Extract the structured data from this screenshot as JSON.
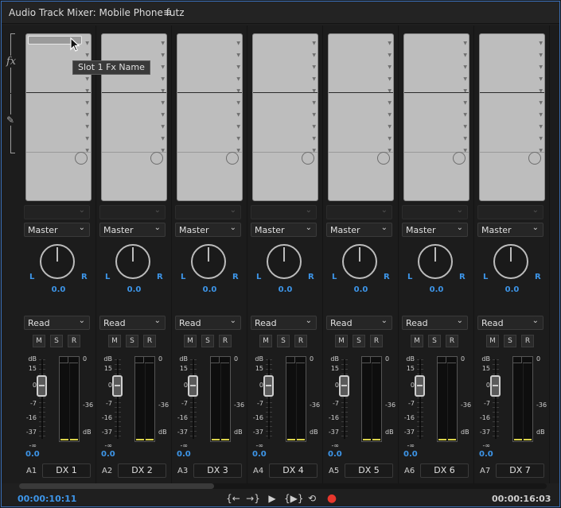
{
  "panel": {
    "title": "Audio Track Mixer: Mobile Phone futz",
    "menu_icon": "hamburger-menu-icon"
  },
  "row_labels": {
    "fx": "fx",
    "send_icon": "send-icon"
  },
  "tooltip": "Slot 1 Fx Name",
  "channels": [
    {
      "track_id": "A1",
      "name": "DX 1",
      "output": "Master",
      "automation": "Read",
      "pan_value": "0.0",
      "volume_value": "0.0",
      "pan_l": "L",
      "pan_r": "R",
      "m": "M",
      "s": "S",
      "r": "R"
    },
    {
      "track_id": "A2",
      "name": "DX 2",
      "output": "Master",
      "automation": "Read",
      "pan_value": "0.0",
      "volume_value": "0.0",
      "pan_l": "L",
      "pan_r": "R",
      "m": "M",
      "s": "S",
      "r": "R"
    },
    {
      "track_id": "A3",
      "name": "DX 3",
      "output": "Master",
      "automation": "Read",
      "pan_value": "0.0",
      "volume_value": "0.0",
      "pan_l": "L",
      "pan_r": "R",
      "m": "M",
      "s": "S",
      "r": "R"
    },
    {
      "track_id": "A4",
      "name": "DX 4",
      "output": "Master",
      "automation": "Read",
      "pan_value": "0.0",
      "volume_value": "0.0",
      "pan_l": "L",
      "pan_r": "R",
      "m": "M",
      "s": "S",
      "r": "R"
    },
    {
      "track_id": "A5",
      "name": "DX 5",
      "output": "Master",
      "automation": "Read",
      "pan_value": "0.0",
      "volume_value": "0.0",
      "pan_l": "L",
      "pan_r": "R",
      "m": "M",
      "s": "S",
      "r": "R"
    },
    {
      "track_id": "A6",
      "name": "DX 6",
      "output": "Master",
      "automation": "Read",
      "pan_value": "0.0",
      "volume_value": "0.0",
      "pan_l": "L",
      "pan_r": "R",
      "m": "M",
      "s": "S",
      "r": "R"
    },
    {
      "track_id": "A7",
      "name": "DX 7",
      "output": "Master",
      "automation": "Read",
      "pan_value": "0.0",
      "volume_value": "0.0",
      "pan_l": "L",
      "pan_r": "R",
      "m": "M",
      "s": "S",
      "r": "R"
    }
  ],
  "fader_scale": {
    "db": "dB",
    "t15": "15",
    "t0": "0",
    "tm7": "-7",
    "tm16": "-16",
    "tm37": "-37",
    "tinf": "-∞"
  },
  "meter_scale": {
    "t0": "0",
    "tm36": "-36",
    "db": "dB"
  },
  "transport": {
    "timecode_left": "00:00:10:11",
    "timecode_right": "00:00:16:03",
    "buttons": [
      "go-to-in-icon",
      "go-to-out-icon",
      "play-icon",
      "play-in-to-out-icon",
      "loop-icon",
      "record-icon"
    ]
  },
  "colors": {
    "accent_blue": "#3d95e8",
    "record_red": "#e8372d",
    "meter_yellow": "#d9d24a",
    "panel_border": "#3a6fb8"
  }
}
